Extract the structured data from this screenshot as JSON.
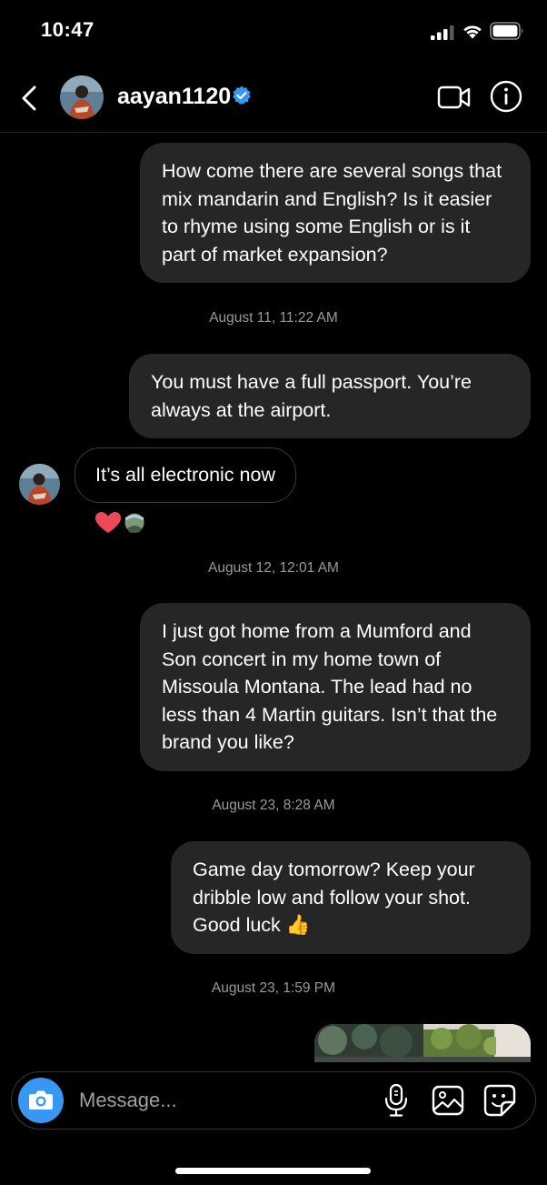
{
  "status_bar": {
    "time": "10:47"
  },
  "header": {
    "username": "aayan1120",
    "icons": [
      "back-icon",
      "avatar",
      "verified-badge-icon",
      "video-call-icon",
      "info-icon"
    ]
  },
  "colors": {
    "background": "#000000",
    "outgoing_bubble": "#262626",
    "verified": "#3897f0",
    "camera_button": "#3897f0",
    "reaction_heart": "#ed4956"
  },
  "messages": [
    {
      "direction": "outgoing",
      "text": "How come there are several songs that mix mandarin and English?  Is it easier to rhyme using some English or is it part of market expansion?"
    },
    {
      "type": "timestamp",
      "text": "August 11, 11:22 AM"
    },
    {
      "direction": "outgoing",
      "text": "You must have a full passport. You’re always at the airport."
    },
    {
      "direction": "incoming",
      "text": "It’s all electronic now",
      "reactions": [
        "heart-icon",
        "reactor-avatar"
      ]
    },
    {
      "type": "timestamp",
      "text": "August 12, 12:01 AM"
    },
    {
      "direction": "outgoing",
      "text": "I just got home from a Mumford and Son concert in my home town of Missoula Montana. The lead had no less than 4 Martin guitars. Isn’t that the brand you like?"
    },
    {
      "type": "timestamp",
      "text": "August 23, 8:28 AM"
    },
    {
      "direction": "outgoing",
      "text": "Game day tomorrow?  Keep your dribble low and follow your shot. Good luck 👍"
    },
    {
      "type": "timestamp",
      "text": "August 23, 1:59 PM"
    },
    {
      "direction": "outgoing",
      "type": "photo"
    }
  ],
  "composer": {
    "placeholder": "Message...",
    "icons": [
      "camera-icon",
      "microphone-icon",
      "gallery-icon",
      "sticker-icon"
    ]
  }
}
